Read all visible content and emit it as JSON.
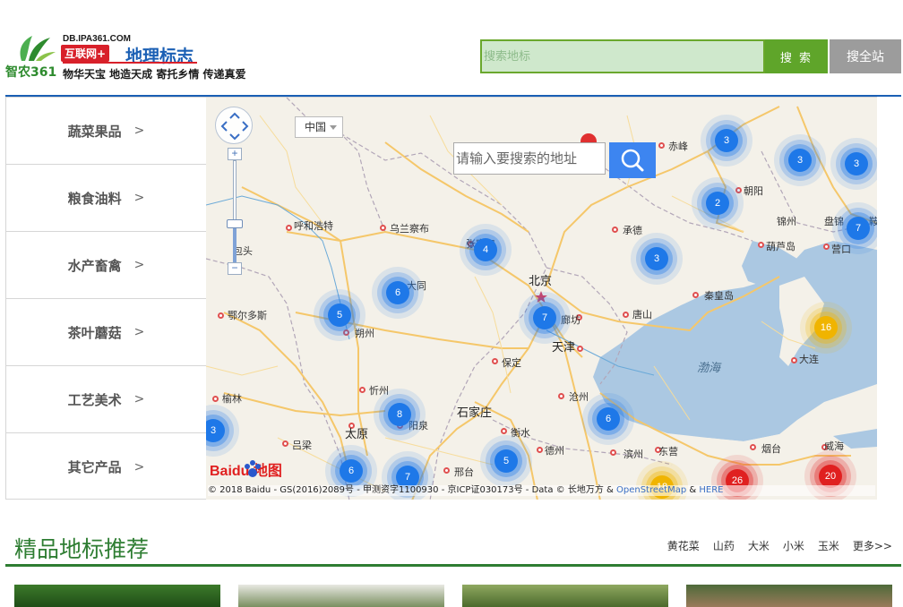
{
  "header": {
    "logo_name": "智农361",
    "logo_domain": "DB.IPA361.COM",
    "logo_badge": "互联网+",
    "logo_title": "地理标志",
    "logo_slogan": "物华天宝 地造天成 寄托乡情 传递真爱",
    "search": {
      "placeholder": "搜索地标",
      "value": "",
      "button_label": "搜 索",
      "search_all_label": "搜全站"
    }
  },
  "categories": [
    {
      "label": "蔬菜果品",
      "arrow": ">"
    },
    {
      "label": "粮食油料",
      "arrow": ">"
    },
    {
      "label": "水产畜禽",
      "arrow": ">"
    },
    {
      "label": "茶叶蘑菇",
      "arrow": ">"
    },
    {
      "label": "工艺美术",
      "arrow": ">"
    },
    {
      "label": "其它产品",
      "arrow": ">"
    }
  ],
  "map": {
    "country_select": "中国",
    "address_search": {
      "placeholder": "请输入要搜索的地址",
      "value": ""
    },
    "zoom": {
      "plus": "+",
      "minus": "−",
      "level_fraction": 0.3
    },
    "baidu_logo": "Baidu 地图",
    "copyright": "© 2018 Baidu - GS(2016)2089号 - 甲测资字1100930 - 京ICP证030173号 - Data © 长地万方 &",
    "copyright_links": {
      "osm": "OpenStreetMap",
      "amp": "&",
      "here": "HERE"
    },
    "place_labels": {
      "beijing": "北京",
      "tianjin": "天津",
      "langfang": "廊坊",
      "baoding": "保定",
      "shijiazhuang": "石家庄",
      "taiyuan": "太原",
      "hohhot": "呼和浩特",
      "wulanchabu": "乌兰察布",
      "zhangjiakou": "张家口",
      "chengde": "承德",
      "chifeng": "赤峰",
      "chaoyang": "朝阳",
      "jinzhou": "锦州",
      "panjin": "盘锦",
      "huludao": "葫芦岛",
      "yingkou": "营口",
      "qinhuangdao": "秦皇岛",
      "tangshan": "唐山",
      "dalian": "大连",
      "ordos": "鄂尔多斯",
      "shuozhou": "朔州",
      "datong": "大同",
      "xinzhou": "忻州",
      "yangquan": "阳泉",
      "hengshui": "衡水",
      "cangzhou": "沧州",
      "dezhou": "德州",
      "binzhou": "滨州",
      "dongying": "东营",
      "yantai": "烟台",
      "weihai": "威海",
      "xingtai": "邢台",
      "lvliang": "吕梁",
      "yulin": "榆林",
      "baotou": "包头",
      "bohai": "渤海",
      "anshan": "鞍"
    },
    "clusters": [
      {
        "count": "3",
        "level": "blue"
      },
      {
        "count": "3",
        "level": "blue"
      },
      {
        "count": "3",
        "level": "blue"
      },
      {
        "count": "2",
        "level": "blue"
      },
      {
        "count": "7",
        "level": "blue"
      },
      {
        "count": "4",
        "level": "blue"
      },
      {
        "count": "3",
        "level": "blue"
      },
      {
        "count": "6",
        "level": "blue"
      },
      {
        "count": "5",
        "level": "blue"
      },
      {
        "count": "7",
        "level": "blue"
      },
      {
        "count": "16",
        "level": "yellow"
      },
      {
        "count": "3",
        "level": "blue"
      },
      {
        "count": "8",
        "level": "blue"
      },
      {
        "count": "6",
        "level": "blue"
      },
      {
        "count": "6",
        "level": "blue"
      },
      {
        "count": "7",
        "level": "blue"
      },
      {
        "count": "5",
        "level": "blue"
      },
      {
        "count": "26",
        "level": "red"
      },
      {
        "count": "20",
        "level": "red"
      },
      {
        "count": "18",
        "level": "yellow"
      }
    ]
  },
  "recommend": {
    "title": "精品地标推荐",
    "tags": [
      "黄花菜",
      "山药",
      "大米",
      "小米",
      "玉米",
      "更多>>"
    ]
  },
  "colors": {
    "brand_green": "#2e7d32",
    "search_green": "#5fa52a",
    "nav_blue": "#1a5fb4",
    "cluster_blue": "#1e78e8",
    "cluster_yellow": "#f0b400",
    "cluster_red": "#e02020"
  }
}
